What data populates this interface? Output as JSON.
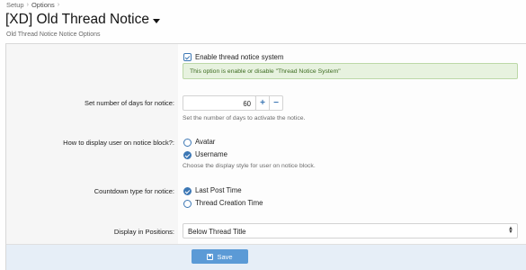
{
  "breadcrumb": {
    "items": [
      "Setup",
      "Options"
    ]
  },
  "page": {
    "title": "[XD] Old Thread Notice",
    "description": "Old Thread Notice Notice Options"
  },
  "enable": {
    "label": "Enable thread notice system",
    "checked": true,
    "message": "This option is enable or disable \"Thread Notice System\""
  },
  "days": {
    "label": "Set number of days for notice:",
    "value": "60",
    "plus": "+",
    "minus": "−",
    "hint": "Set the number of days to activate the notice."
  },
  "display_user": {
    "label": "How to display user on notice block?:",
    "options": [
      "Avatar",
      "Username"
    ],
    "selected": "Username",
    "hint": "Choose the display style for user on notice block."
  },
  "countdown": {
    "label": "Countdown type for notice:",
    "options": [
      "Last Post Time",
      "Thread Creation Time"
    ],
    "selected": "Last Post Time"
  },
  "positions": {
    "label": "Display in Positions:",
    "value": "Below Thread Title"
  },
  "footer": {
    "save_label": "Save"
  },
  "colors": {
    "accent": "#3d78b5",
    "button": "#5b9ad6",
    "success_bg": "#e7f2df"
  }
}
